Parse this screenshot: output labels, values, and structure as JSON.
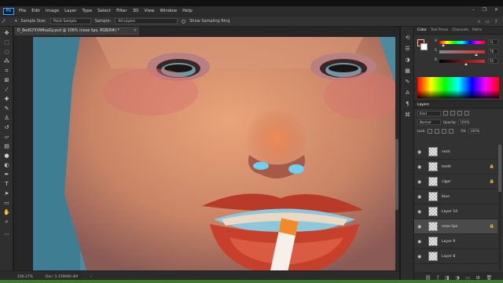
{
  "app": {
    "logo": "Ps",
    "menu": [
      "File",
      "Edit",
      "Image",
      "Layer",
      "Type",
      "Select",
      "Filter",
      "3D",
      "View",
      "Window",
      "Help"
    ]
  },
  "options": {
    "sample_size_label": "Sample Size:",
    "sample_size_value": "Point Sample",
    "sample_label": "Sample:",
    "sample_value": "All Layers",
    "sampling_ring_label": "Show Sampling Ring"
  },
  "document": {
    "tab_title": "D_8edS7XYAMsaGy.psd @ 106% (nose lips, RGB/8#) *",
    "zoom": "106.27%",
    "doc_info": "Doc: 5.15M/80.4M"
  },
  "color_panel": {
    "tabs": [
      "Color",
      "Tool Prese",
      "Channels",
      "Paths"
    ],
    "active_tab": "Color",
    "foreground_color": "#6a1a10",
    "background_color": "#ffffff",
    "sliders": [
      {
        "label": "H",
        "value": "11"
      },
      {
        "label": "S",
        "value": "78"
      },
      {
        "label": "B",
        "value": "55"
      }
    ]
  },
  "layers_panel": {
    "title": "Layers",
    "filter_kind": "Kind",
    "blend_mode": "Normal",
    "opacity_label": "Opacity:",
    "opacity_value": "100%",
    "lock_label": "Lock:",
    "fill_label": "Fill:",
    "fill_value": "100%",
    "layers": [
      {
        "name": "neck",
        "visible": true,
        "selected": false
      },
      {
        "name": "teeth",
        "visible": true,
        "selected": false
      },
      {
        "name": "cigar",
        "visible": true,
        "selected": false
      },
      {
        "name": "blue",
        "visible": true,
        "selected": false
      },
      {
        "name": "Layer 10",
        "visible": true,
        "selected": false
      },
      {
        "name": "nose lips",
        "visible": true,
        "selected": true
      },
      {
        "name": "Layer 9",
        "visible": true,
        "selected": false
      },
      {
        "name": "Layer 8",
        "visible": true,
        "selected": false
      }
    ]
  },
  "colors": {
    "accent": "#31a8ff",
    "ui_dark": "#323232"
  }
}
